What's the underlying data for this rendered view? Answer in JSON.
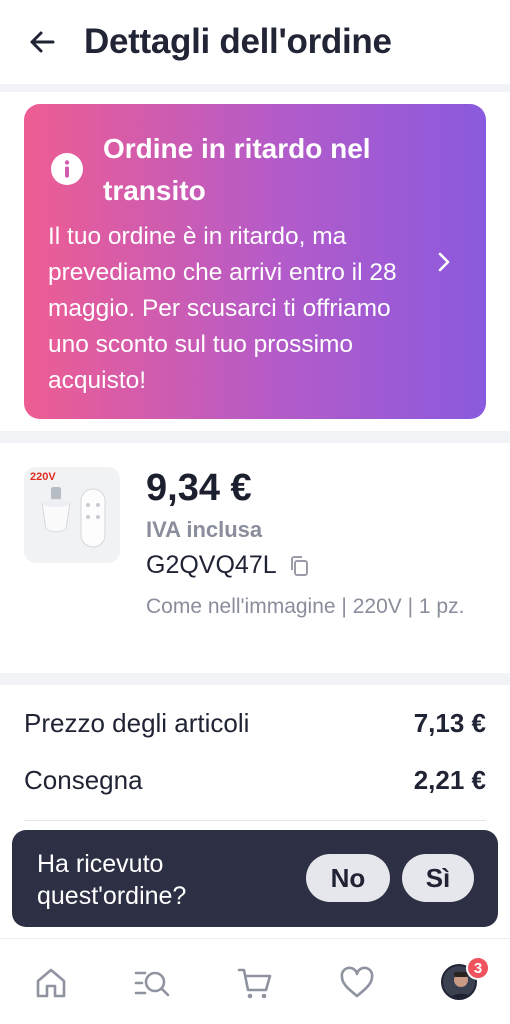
{
  "header": {
    "title": "Dettagli dell'ordine"
  },
  "banner": {
    "title": "Ordine in ritardo nel transito",
    "message": "Il tuo ordine è in ritardo, ma prevediamo che arrivi entro il 28 maggio. Per scusarci ti offriamo uno sconto sul tuo prossimo acquisto!",
    "gradient_start": "#ee5d92",
    "gradient_end": "#8a5ade"
  },
  "product": {
    "image_label": "220V",
    "price": "9,34 €",
    "vat_note": "IVA inclusa",
    "sku": "G2QVQ47L",
    "variant": "Come nell'immagine | 220V | 1 pz."
  },
  "summary": {
    "items_label": "Prezzo degli articoli",
    "items_value": "7,13 €",
    "delivery_label": "Consegna",
    "delivery_value": "2,21 €"
  },
  "received_prompt": {
    "question": "Ha ricevuto quest'ordine?",
    "no_label": "No",
    "yes_label": "Sì"
  },
  "bottom_nav": {
    "items": [
      "home-icon",
      "search-list-icon",
      "cart-icon",
      "heart-icon",
      "avatar"
    ],
    "badge_count": "3",
    "badge_color": "#f0535e"
  }
}
